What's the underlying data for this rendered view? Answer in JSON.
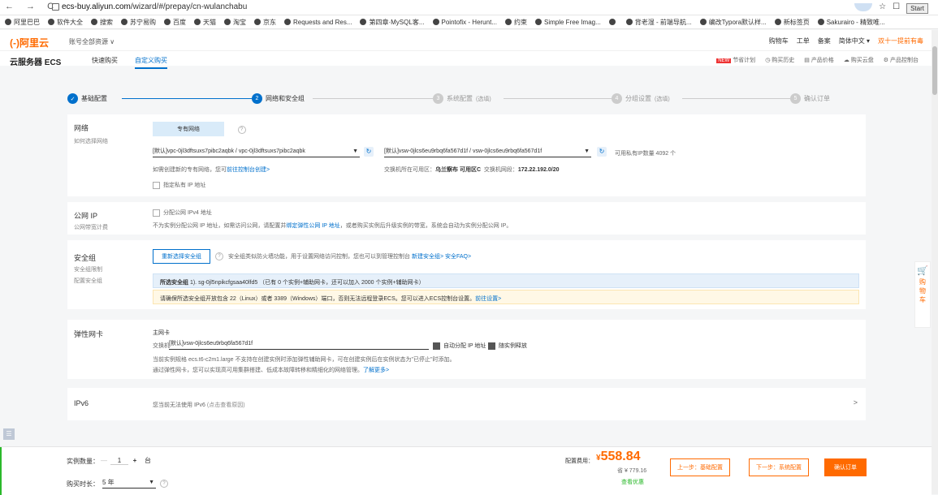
{
  "browser": {
    "url_domain": "ecs-buy.aliyun.com",
    "url_path": "/wizard/#/prepay/cn-wulanchabu",
    "start_label": "Start",
    "bookmarks": [
      "阿里巴巴",
      "软件大全",
      "搜索",
      "苏宁易购",
      "百度",
      "天猫",
      "淘宝",
      "京东",
      "Requests and Res...",
      "第四章·MySQL客...",
      "Pointofix - Herunt...",
      "约束",
      "Simple Free Imag...",
      "",
      "背老湿 - 前端导航...",
      "编改Typora默认样...",
      "新标签页",
      "Sakurairo - 精致唯..."
    ]
  },
  "header": {
    "logo": "(-)阿里云",
    "account_menu": "账号全部资源 ∨",
    "right_links": [
      "购物车",
      "工单",
      "备案",
      "简体中文 ▾"
    ],
    "hot_link": "双十一提前有毒",
    "product_title": "云服务器 ECS",
    "tabs": [
      "快速购买",
      "自定义购买"
    ],
    "active_tab": 1,
    "sub_links": [
      "节省计划",
      "购买历史",
      "产品价格",
      "购买云盘",
      "产品控制台"
    ],
    "new_tag": "NEW"
  },
  "steps": [
    {
      "num": "✓",
      "label": "基础配置",
      "opt": ""
    },
    {
      "num": "2",
      "label": "网络和安全组",
      "opt": ""
    },
    {
      "num": "3",
      "label": "系统配置",
      "opt": "(选填)"
    },
    {
      "num": "4",
      "label": "分组设置",
      "opt": "(选填)"
    },
    {
      "num": "5",
      "label": "确认订单",
      "opt": ""
    }
  ],
  "network": {
    "label": "网络",
    "sub": "如何选择网络",
    "type_btn": "专有网络",
    "vpc_value": "[默认]vpc-0jl3dftsuxs7pibc2aqbk / vpc-0jl3dftsuxs7pibc2aqbk",
    "vsw_value": "[默认]vsw-0jlcs6eu9rbq6fa567d1f / vsw-0jlcs6eu9rbq6fa567d1f",
    "ip_count": "可用私有IP数量 4092 个",
    "create_hint": "如需创建新的专有网络，您可",
    "create_link": "前往控制台创建>",
    "zone_text_1": "交换机所在可用区：",
    "zone_value": "乌兰察布 可用区C",
    "cidr_text": "交换机网段：",
    "cidr_value": "172.22.192.0/20",
    "private_ip": "指定私有 IP 地址"
  },
  "public_ip": {
    "label": "公网 IP",
    "sub": "公网带宽计费",
    "checkbox": "分配公网 IPv4 地址",
    "hint_1": "不为实例分配公网 IP 地址，如需访问公网，请配置并",
    "hint_link": "绑定弹性公网 IP 地址",
    "hint_2": "，或者购买实例后升级实例的带宽，系统会自动为实例分配公网 IP。"
  },
  "security": {
    "label": "安全组",
    "sub_1": "安全组限制",
    "sub_2": "配置安全组",
    "reselect_btn": "重新选择安全组",
    "hint": "安全组类似防火墙功能，用于设置网络访问控制，您也可以到管理控制台",
    "link_new": "新建安全组>",
    "link_faq": "安全FAQ>",
    "selected_bold": "所选安全组",
    "selected_text": "1). sg-0jl5npikcfgsaa40lfd5 （已有 0 个实例+辅助网卡，还可以加入 2000 个实例+辅助网卡）",
    "warn": "请确保所选安全组开放包含 22（Linux）或者 3389（Windows）端口，否则无法远程登录ECS。您可以进入ECS控制台设置。",
    "warn_link": "前往设置>"
  },
  "eni": {
    "label": "弹性网卡",
    "primary": "主网卡",
    "switch_label": "交换机",
    "switch_value": "[默认]vsw-0jlcs6eu9rbq6fa567d1f",
    "auto_ip": "自动分配 IP 地址",
    "release": "随实例释放",
    "note_1": "当前实例规格 ecs.t6-c2m1.large 不支持在创建实例时添加弹性辅助网卡，可在创建实例后在实例状态为\"已停止\"时添加。",
    "note_2": "通过弹性网卡，您可以实现高可用集群搭建、低成本故障转移和精细化的网络管理。",
    "note_link": "了解更多>"
  },
  "ipv6": {
    "label": "IPv6",
    "text": "您当前无法使用 IPv6",
    "reason": "(点击查看原因)",
    "chevron": ">"
  },
  "bottom": {
    "qty_label": "实例数量：",
    "qty_minus": "—",
    "qty_value": "1",
    "qty_plus": "+",
    "qty_unit": "台",
    "duration_label": "购买时长：",
    "duration_value": "5 年",
    "price_label": "配置费用：",
    "price_currency": "¥",
    "price_value": "558.84",
    "price_orig": "省 ¥ 779.16",
    "discount_link": "查看优惠",
    "prev_btn": "上一步：基础配置",
    "next_btn": "下一步：系统配置",
    "confirm_btn": "确认订单"
  },
  "side_cart": "购物车",
  "colors": {
    "accent": "#0070cc",
    "orange": "#ff6a00",
    "green": "#2ab82a"
  }
}
